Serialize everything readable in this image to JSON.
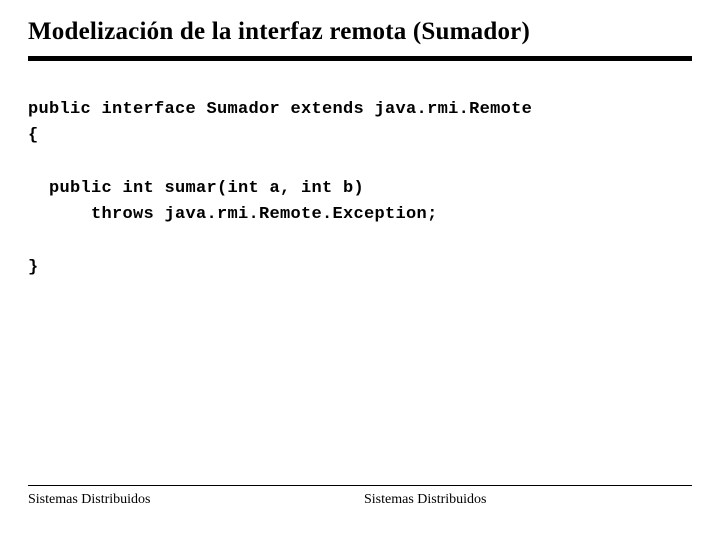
{
  "title": "Modelización de la interfaz remota (Sumador)",
  "code": {
    "line1": "public interface Sumador extends java.rmi.Remote",
    "line2": "{",
    "line3": "  public int sumar(int a, int b)",
    "line4": "      throws java.rmi.Remote.Exception;",
    "line5": "}"
  },
  "footer": {
    "left": "Sistemas Distribuidos",
    "right": "Sistemas Distribuidos"
  }
}
